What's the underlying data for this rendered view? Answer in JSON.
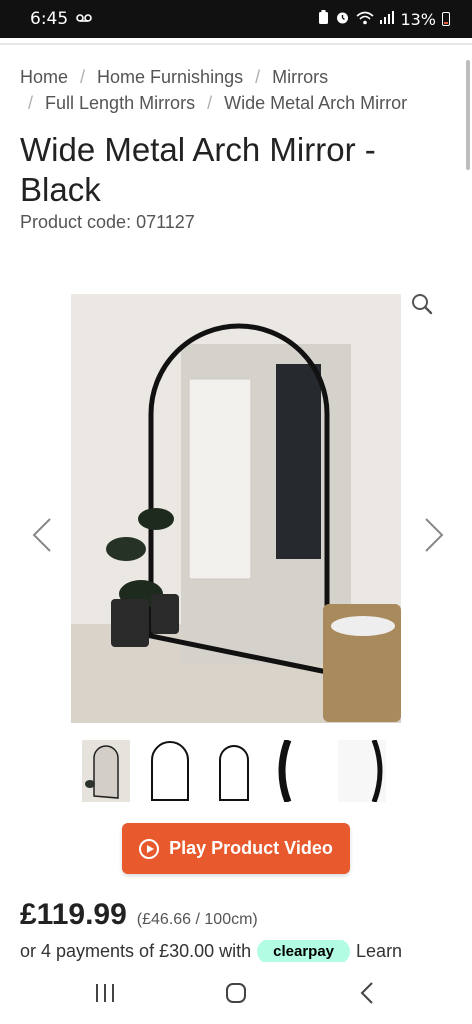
{
  "status_bar": {
    "time": "6:45",
    "voicemail_icon": "voicemail-icon",
    "battery_text": "13%"
  },
  "breadcrumb": {
    "items": [
      "Home",
      "Home Furnishings",
      "Mirrors",
      "Full Length Mirrors",
      "Wide Metal Arch Mirror"
    ],
    "separator": "/"
  },
  "product": {
    "title": "Wide Metal Arch Mirror - Black",
    "code": "Product code: 071127",
    "price": "£119.99",
    "unit_price": "(£46.66 / 100cm)"
  },
  "gallery": {
    "thumbnail_count": 5,
    "icons": [
      "zoom-icon",
      "prev-arrow-icon",
      "next-arrow-icon"
    ]
  },
  "video_button": {
    "label": "Play Product Video"
  },
  "clearpay": {
    "prefix": "or 4 payments of £30.00 with",
    "badge": "clearpay",
    "suffix": "Learn"
  },
  "colors": {
    "accent": "#e85a2e",
    "clearpay": "#b2fce4",
    "status_bar": "#111111"
  }
}
